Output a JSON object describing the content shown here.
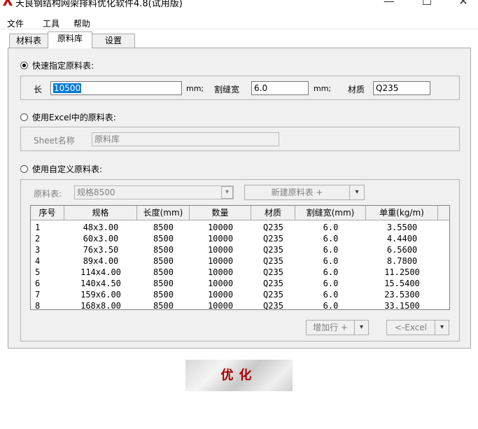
{
  "window": {
    "title": "天良钢结构网架排料优化软件4.8(试用版)",
    "controls": {
      "minimize": "—",
      "maximize": "☐",
      "close": "✕"
    },
    "logo_color": "#c00000"
  },
  "menu": [
    "文件",
    "工具",
    "帮助"
  ],
  "tabs": [
    "材料表",
    "原料库",
    "设置"
  ],
  "quick": {
    "label": "快速指定原料表:",
    "length_label": "长",
    "length_value": "10500",
    "unit1": "mm;",
    "kerf_label": "割缝宽",
    "kerf_value": "6.0",
    "unit2": "mm;",
    "material_label": "材质",
    "material_value": "Q235"
  },
  "excel": {
    "label": "使用Excel中的原料表:",
    "sheet_label": "Sheet名称",
    "sheet_value": "原料库"
  },
  "custom": {
    "label": "使用自定义原料表:",
    "table_label": "原料表:",
    "table_value": "规格8500",
    "new_button": "新建原料表 +",
    "add_row_button": "增加行 +",
    "excel_button": "<-Excel"
  },
  "table": {
    "columns": [
      "序号",
      "规格",
      "长度(mm)",
      "数量",
      "材质",
      "割缝宽(mm)",
      "单重(kg/m)"
    ],
    "rows": [
      [
        "1",
        "48x3.00",
        "8500",
        "10000",
        "Q235",
        "6.0",
        "3.5500"
      ],
      [
        "2",
        "60x3.00",
        "8500",
        "10000",
        "Q235",
        "6.0",
        "4.4400"
      ],
      [
        "3",
        "76x3.50",
        "8500",
        "10000",
        "Q235",
        "6.0",
        "6.5600"
      ],
      [
        "4",
        "89x4.00",
        "8500",
        "10000",
        "Q235",
        "6.0",
        "8.7800"
      ],
      [
        "5",
        "114x4.00",
        "8500",
        "10000",
        "Q235",
        "6.0",
        "11.2500"
      ],
      [
        "6",
        "140x4.50",
        "8500",
        "10000",
        "Q235",
        "6.0",
        "15.5400"
      ],
      [
        "7",
        "159x6.00",
        "8500",
        "10000",
        "Q235",
        "6.0",
        "23.5300"
      ],
      [
        "8",
        "168x8.00",
        "8500",
        "10000",
        "Q235",
        "6.0",
        "33.1500"
      ]
    ]
  },
  "optimize_button": "优化",
  "icons": {
    "dropdown": "▾",
    "scroll_up": "˄",
    "scroll_down": "˅"
  }
}
